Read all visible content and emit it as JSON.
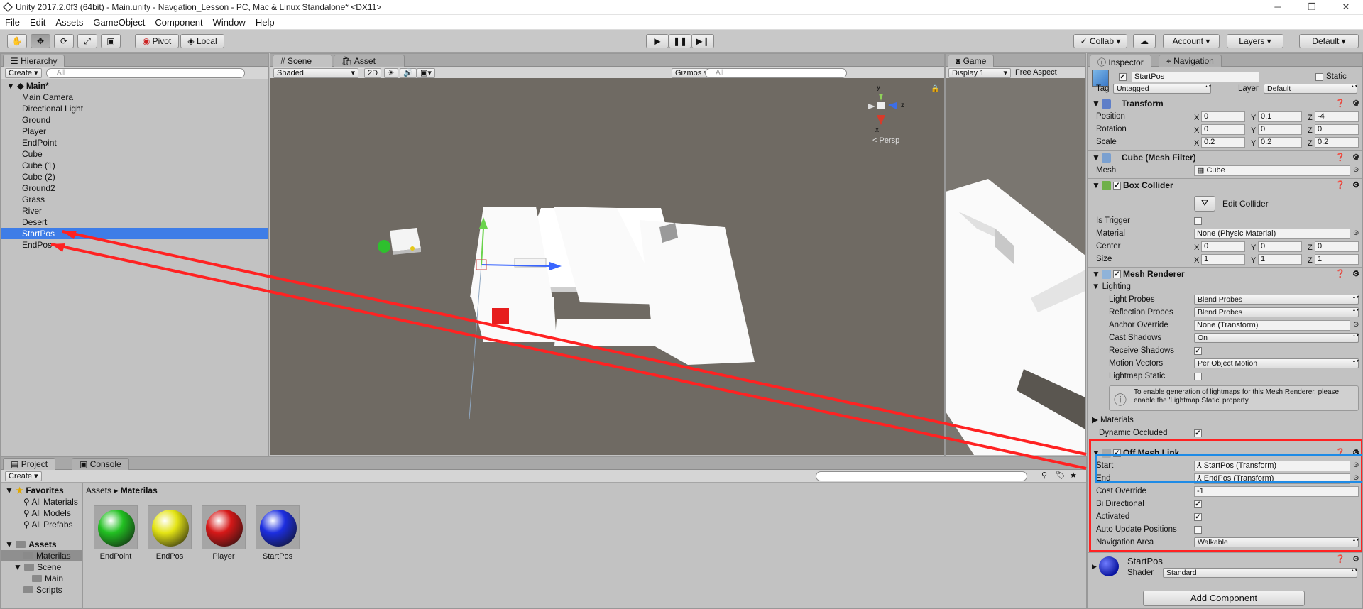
{
  "window": {
    "title": "Unity 2017.2.0f3 (64bit) - Main.unity - Navgation_Lesson - PC, Mac & Linux Standalone* <DX11>"
  },
  "menu": [
    "File",
    "Edit",
    "Assets",
    "GameObject",
    "Component",
    "Window",
    "Help"
  ],
  "toolbar": {
    "pivot": "Pivot",
    "local": "Local",
    "collab": "Collab",
    "account": "Account",
    "layers": "Layers",
    "layout": "Default"
  },
  "hierarchy": {
    "tab": "Hierarchy",
    "create": "Create",
    "search_placeholder": "All",
    "scene": "Main*",
    "items": [
      "Main Camera",
      "Directional Light",
      "Ground",
      "Player",
      "EndPoint",
      "Cube",
      "Cube (1)",
      "Cube (2)",
      "Ground2",
      "Grass",
      "River",
      "Desert",
      "StartPos",
      "EndPos"
    ],
    "selected": "StartPos"
  },
  "scene": {
    "tab": "Scene",
    "store_tab": "Asset Store",
    "shading": "Shaded",
    "mode_2d": "2D",
    "gizmos": "Gizmos",
    "search_placeholder": "All",
    "persp": "Persp",
    "axis_y": "y",
    "axis_z": "z",
    "axis_x": "x"
  },
  "game": {
    "tab": "Game",
    "display": "Display 1",
    "aspect": "Free Aspect"
  },
  "project": {
    "tab": "Project",
    "console_tab": "Console",
    "create": "Create",
    "favorites": "Favorites",
    "fav_items": [
      "All Materials",
      "All Models",
      "All Prefabs"
    ],
    "assets": "Assets",
    "folders": [
      "Materilas",
      "Scene",
      "Main",
      "Scripts"
    ],
    "breadcrumb_root": "Assets",
    "breadcrumb_current": "Materilas",
    "materials": [
      {
        "name": "EndPoint",
        "color": "#22c022"
      },
      {
        "name": "EndPos",
        "color": "#e4e415"
      },
      {
        "name": "Player",
        "color": "#d61818"
      },
      {
        "name": "StartPos",
        "color": "#1c2ee0"
      }
    ]
  },
  "inspector": {
    "tab": "Inspector",
    "nav_tab": "Navigation",
    "object_name": "StartPos",
    "static": "Static",
    "tag_label": "Tag",
    "tag": "Untagged",
    "layer_label": "Layer",
    "layer": "Default",
    "transform": {
      "title": "Transform",
      "position_label": "Position",
      "rotation_label": "Rotation",
      "scale_label": "Scale",
      "position": [
        "0",
        "0.1",
        "-4"
      ],
      "rotation": [
        "0",
        "0",
        "0"
      ],
      "scale": [
        "0.2",
        "0.2",
        "0.2"
      ]
    },
    "axis": [
      "X",
      "Y",
      "Z"
    ],
    "mesh_filter": {
      "title": "Cube (Mesh Filter)",
      "mesh_label": "Mesh",
      "mesh": "Cube"
    },
    "box_collider": {
      "title": "Box Collider",
      "edit": "Edit Collider",
      "is_trigger": "Is Trigger",
      "material_label": "Material",
      "material": "None (Physic Material)",
      "center_label": "Center",
      "center": [
        "0",
        "0",
        "0"
      ],
      "size_label": "Size",
      "size": [
        "1",
        "1",
        "1"
      ]
    },
    "mesh_renderer": {
      "title": "Mesh Renderer",
      "lighting": "Lighting",
      "light_probes_label": "Light Probes",
      "light_probes": "Blend Probes",
      "reflection_label": "Reflection Probes",
      "reflection": "Blend Probes",
      "anchor_label": "Anchor Override",
      "anchor": "None (Transform)",
      "cast_label": "Cast Shadows",
      "cast": "On",
      "receive_label": "Receive Shadows",
      "motion_label": "Motion Vectors",
      "motion": "Per Object Motion",
      "lightmap_label": "Lightmap Static",
      "info": "To enable generation of lightmaps for this Mesh Renderer, please enable the 'Lightmap Static' property.",
      "materials": "Materials",
      "dynamic_label": "Dynamic Occluded"
    },
    "off_mesh_link": {
      "title": "Off Mesh Link",
      "start_label": "Start",
      "start": "StartPos (Transform)",
      "end_label": "End",
      "end": "EndPos (Transform)",
      "cost_label": "Cost Override",
      "cost": "-1",
      "bi_label": "Bi Directional",
      "activated_label": "Activated",
      "auto_label": "Auto Update Positions",
      "area_label": "Navigation Area",
      "area": "Walkable"
    },
    "material": {
      "name": "StartPos",
      "shader_label": "Shader",
      "shader": "Standard"
    },
    "add_component": "Add Component"
  },
  "colors": {
    "selection": "#3e7de7",
    "annotation_red": "#ff2222",
    "annotation_blue": "#1e8be6"
  }
}
